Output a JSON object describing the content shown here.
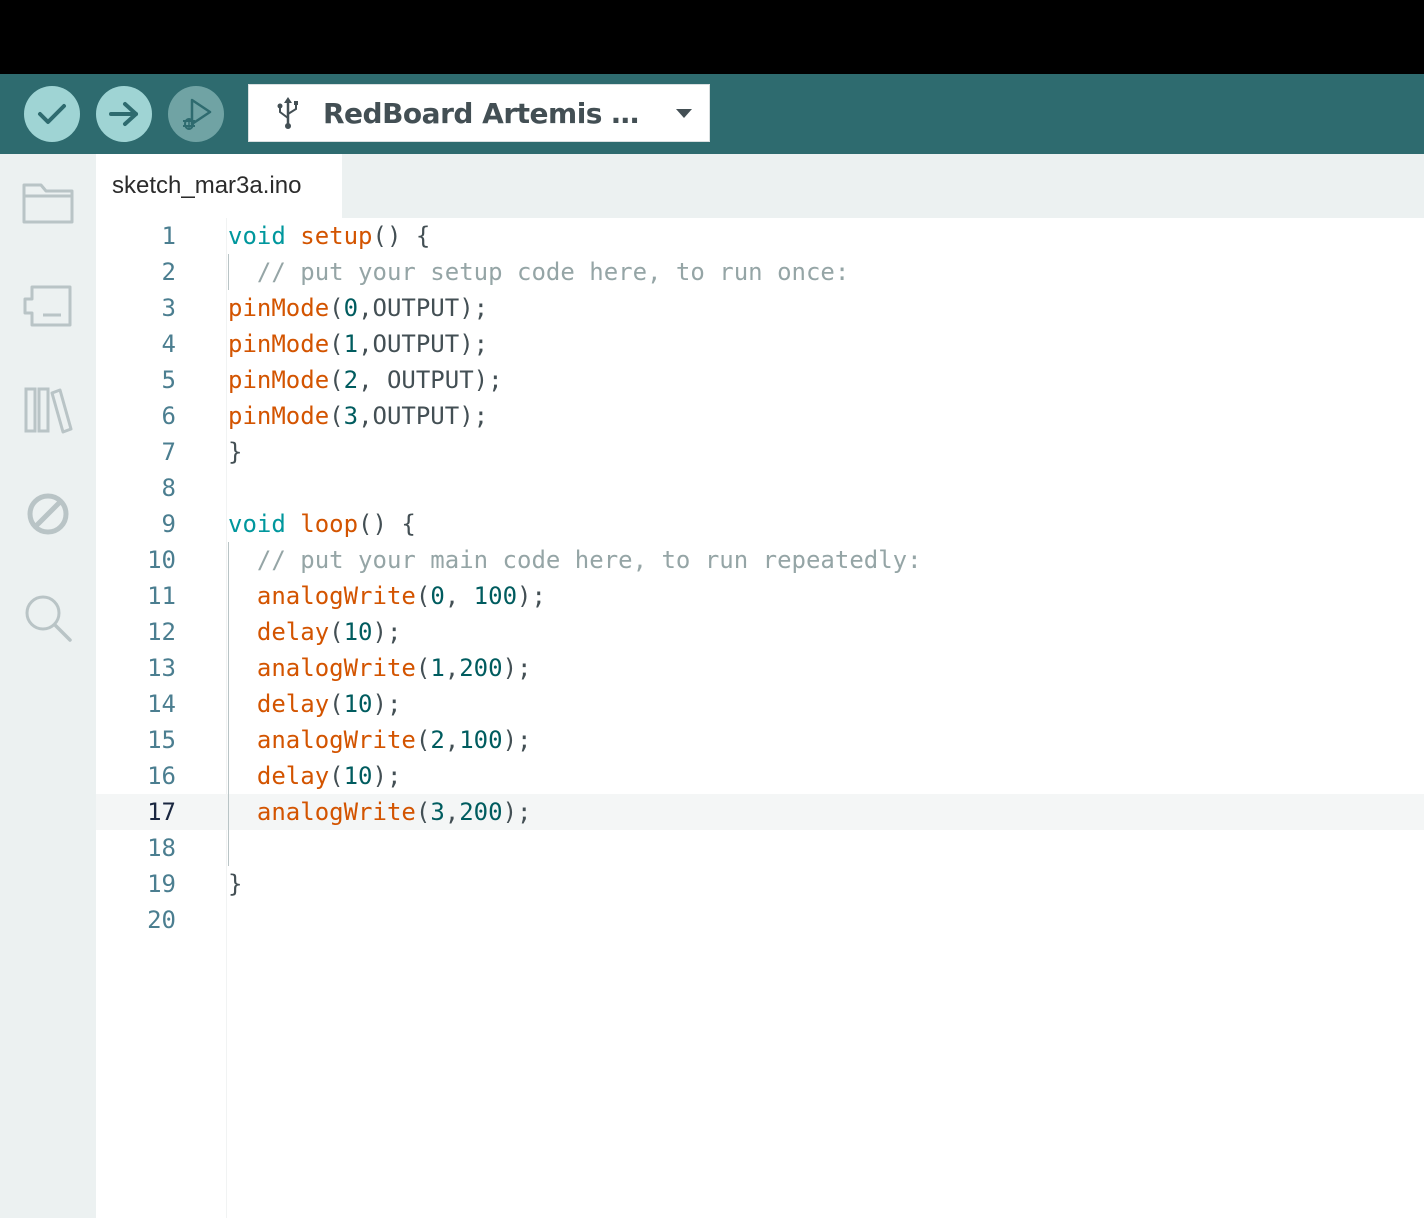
{
  "toolbar": {
    "verify_icon": "check-icon",
    "upload_icon": "arrow-right-icon",
    "debug_icon": "debug-play-icon",
    "board_icon": "usb-icon",
    "board_label": "RedBoard Artemis N...",
    "dropdown_icon": "caret-down-icon",
    "bg_color": "#2e6b6f",
    "button_color": "#9fd4d4"
  },
  "sidebar": {
    "items": [
      {
        "name": "sketchbook",
        "icon": "folder-icon"
      },
      {
        "name": "boards-manager",
        "icon": "board-icon"
      },
      {
        "name": "library-manager",
        "icon": "library-icon"
      },
      {
        "name": "debug",
        "icon": "no-entry-icon"
      },
      {
        "name": "search",
        "icon": "search-icon"
      }
    ]
  },
  "tabs": [
    {
      "label": "sketch_mar3a.ino",
      "active": true
    }
  ],
  "editor": {
    "current_line": 17,
    "lines": [
      {
        "n": "1",
        "segs": [
          [
            "kw",
            "void"
          ],
          [
            "pl",
            " "
          ],
          [
            "fn",
            "setup"
          ],
          [
            "pl",
            "() {"
          ]
        ]
      },
      {
        "n": "2",
        "guide": true,
        "segs": [
          [
            "pl",
            "  "
          ],
          [
            "cm",
            "// put your setup code here, to run once:"
          ]
        ]
      },
      {
        "n": "3",
        "segs": [
          [
            "fn",
            "pinMode"
          ],
          [
            "pl",
            "("
          ],
          [
            "num",
            "0"
          ],
          [
            "pl",
            ",OUTPUT);"
          ]
        ]
      },
      {
        "n": "4",
        "segs": [
          [
            "fn",
            "pinMode"
          ],
          [
            "pl",
            "("
          ],
          [
            "num",
            "1"
          ],
          [
            "pl",
            ",OUTPUT);"
          ]
        ]
      },
      {
        "n": "5",
        "segs": [
          [
            "fn",
            "pinMode"
          ],
          [
            "pl",
            "("
          ],
          [
            "num",
            "2"
          ],
          [
            "pl",
            ", OUTPUT);"
          ]
        ]
      },
      {
        "n": "6",
        "segs": [
          [
            "fn",
            "pinMode"
          ],
          [
            "pl",
            "("
          ],
          [
            "num",
            "3"
          ],
          [
            "pl",
            ",OUTPUT);"
          ]
        ]
      },
      {
        "n": "7",
        "segs": [
          [
            "pl",
            "}"
          ]
        ]
      },
      {
        "n": "8",
        "segs": []
      },
      {
        "n": "9",
        "segs": [
          [
            "kw",
            "void"
          ],
          [
            "pl",
            " "
          ],
          [
            "fn",
            "loop"
          ],
          [
            "pl",
            "() {"
          ]
        ]
      },
      {
        "n": "10",
        "guide": true,
        "segs": [
          [
            "pl",
            "  "
          ],
          [
            "cm",
            "// put your main code here, to run repeatedly:"
          ]
        ]
      },
      {
        "n": "11",
        "guide": true,
        "segs": [
          [
            "pl",
            "  "
          ],
          [
            "fn",
            "analogWrite"
          ],
          [
            "pl",
            "("
          ],
          [
            "num",
            "0"
          ],
          [
            "pl",
            ", "
          ],
          [
            "num",
            "100"
          ],
          [
            "pl",
            ");"
          ]
        ]
      },
      {
        "n": "12",
        "guide": true,
        "segs": [
          [
            "pl",
            "  "
          ],
          [
            "fn",
            "delay"
          ],
          [
            "pl",
            "("
          ],
          [
            "num",
            "10"
          ],
          [
            "pl",
            ");"
          ]
        ]
      },
      {
        "n": "13",
        "guide": true,
        "segs": [
          [
            "pl",
            "  "
          ],
          [
            "fn",
            "analogWrite"
          ],
          [
            "pl",
            "("
          ],
          [
            "num",
            "1"
          ],
          [
            "pl",
            ","
          ],
          [
            "num",
            "200"
          ],
          [
            "pl",
            ");"
          ]
        ]
      },
      {
        "n": "14",
        "guide": true,
        "segs": [
          [
            "pl",
            "  "
          ],
          [
            "fn",
            "delay"
          ],
          [
            "pl",
            "("
          ],
          [
            "num",
            "10"
          ],
          [
            "pl",
            ");"
          ]
        ]
      },
      {
        "n": "15",
        "guide": true,
        "segs": [
          [
            "pl",
            "  "
          ],
          [
            "fn",
            "analogWrite"
          ],
          [
            "pl",
            "("
          ],
          [
            "num",
            "2"
          ],
          [
            "pl",
            ","
          ],
          [
            "num",
            "100"
          ],
          [
            "pl",
            ");"
          ]
        ]
      },
      {
        "n": "16",
        "guide": true,
        "segs": [
          [
            "pl",
            "  "
          ],
          [
            "fn",
            "delay"
          ],
          [
            "pl",
            "("
          ],
          [
            "num",
            "10"
          ],
          [
            "pl",
            ");"
          ]
        ]
      },
      {
        "n": "17",
        "guide": true,
        "segs": [
          [
            "pl",
            "  "
          ],
          [
            "fn",
            "analogWrite"
          ],
          [
            "pl",
            "("
          ],
          [
            "num",
            "3"
          ],
          [
            "pl",
            ","
          ],
          [
            "num",
            "200"
          ],
          [
            "pl",
            ");"
          ]
        ]
      },
      {
        "n": "18",
        "guide": true,
        "segs": []
      },
      {
        "n": "19",
        "segs": [
          [
            "pl",
            "}"
          ]
        ]
      },
      {
        "n": "20",
        "segs": []
      }
    ]
  }
}
